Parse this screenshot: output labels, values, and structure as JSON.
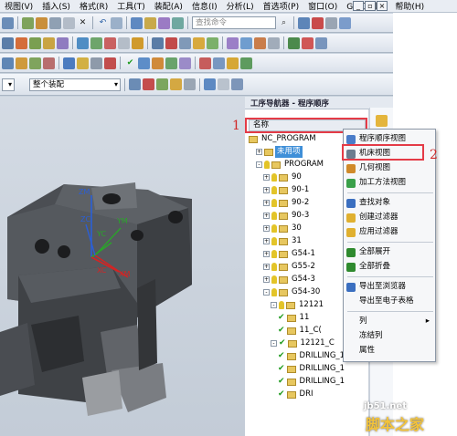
{
  "menu": [
    "视图(V)",
    "插入(S)",
    "格式(R)",
    "工具(T)",
    "装配(A)",
    "信息(I)",
    "分析(L)",
    "首选项(P)",
    "窗口(O)",
    "GC 工具箱",
    "帮助(H)"
  ],
  "window_buttons": {
    "minimize": "_",
    "restore": "▫",
    "close": "×"
  },
  "toolbar": {
    "command_search_placeholder": "查找命令",
    "assembly_select": "整个装配"
  },
  "navigator": {
    "title": "工序导航器 - 程序顺序",
    "column_header": "名称",
    "tree": [
      {
        "label": "NC_PROGRAM",
        "level": 0,
        "toggle": "",
        "bulb": false,
        "check": false
      },
      {
        "label": "未用项",
        "level": 1,
        "toggle": "+",
        "bulb": false,
        "check": false,
        "highlight": true
      },
      {
        "label": "PROGRAM",
        "level": 1,
        "toggle": "-",
        "bulb": true,
        "check": false
      },
      {
        "label": "90",
        "level": 2,
        "toggle": "+",
        "bulb": true,
        "check": false
      },
      {
        "label": "90-1",
        "level": 2,
        "toggle": "+",
        "bulb": true,
        "check": false
      },
      {
        "label": "90-2",
        "level": 2,
        "toggle": "+",
        "bulb": true,
        "check": false
      },
      {
        "label": "90-3",
        "level": 2,
        "toggle": "+",
        "bulb": true,
        "check": false
      },
      {
        "label": "30",
        "level": 2,
        "toggle": "+",
        "bulb": true,
        "check": false
      },
      {
        "label": "31",
        "level": 2,
        "toggle": "+",
        "bulb": true,
        "check": false
      },
      {
        "label": "G54-1",
        "level": 2,
        "toggle": "+",
        "bulb": true,
        "check": false
      },
      {
        "label": "G55-2",
        "level": 2,
        "toggle": "+",
        "bulb": true,
        "check": false
      },
      {
        "label": "G54-3",
        "level": 2,
        "toggle": "+",
        "bulb": true,
        "check": false
      },
      {
        "label": "G54-30",
        "level": 2,
        "toggle": "-",
        "bulb": true,
        "check": false
      },
      {
        "label": "12121",
        "level": 3,
        "toggle": "-",
        "bulb": true,
        "check": false
      },
      {
        "label": "11",
        "level": 4,
        "toggle": "",
        "bulb": false,
        "check": true
      },
      {
        "label": "11_C(",
        "level": 4,
        "toggle": "",
        "bulb": false,
        "check": true
      },
      {
        "label": "12121_C",
        "level": 3,
        "toggle": "-",
        "bulb": false,
        "check": true
      },
      {
        "label": "DRILLING_1",
        "level": 4,
        "toggle": "",
        "bulb": false,
        "check": true
      },
      {
        "label": "DRILLING_1",
        "level": 4,
        "toggle": "",
        "bulb": false,
        "check": true
      },
      {
        "label": "DRILLING_1",
        "level": 4,
        "toggle": "",
        "bulb": false,
        "check": true
      },
      {
        "label": "DRI",
        "level": 4,
        "toggle": "",
        "bulb": false,
        "check": true
      }
    ]
  },
  "context_menu": {
    "items": [
      {
        "label": "程序顺序视图",
        "icon": "program-order-view-icon",
        "color": "#4a7cc9"
      },
      {
        "label": "机床视图",
        "icon": "machine-view-icon",
        "color": "#6b7c8f",
        "boxed": true
      },
      {
        "label": "几何视图",
        "icon": "geometry-view-icon",
        "color": "#d08a2a"
      },
      {
        "label": "加工方法视图",
        "icon": "method-view-icon",
        "color": "#3aa04a"
      },
      {
        "label": "查找对象",
        "icon": "find-object-icon",
        "color": "#3b6fc0"
      },
      {
        "label": "创建过滤器",
        "icon": "create-filter-icon",
        "color": "#e0b030"
      },
      {
        "label": "应用过滤器",
        "icon": "apply-filter-icon",
        "color": "#e0b030"
      },
      {
        "label": "全部展开",
        "icon": "expand-all-icon",
        "color": "#2f8a2f"
      },
      {
        "label": "全部折叠",
        "icon": "collapse-all-icon",
        "color": "#2f8a2f"
      },
      {
        "label": "导出至浏览器",
        "icon": "export-browser-icon",
        "color": "#3b6fc0"
      },
      {
        "label": "导出至电子表格",
        "icon": "",
        "color": ""
      },
      {
        "label": "列",
        "icon": "",
        "color": "",
        "arrow": "▸"
      },
      {
        "label": "冻结列",
        "icon": "",
        "color": ""
      },
      {
        "label": "属性",
        "icon": "",
        "color": ""
      }
    ]
  },
  "callouts": {
    "one": "1",
    "two": "2"
  },
  "axes": {
    "zm": "ZM",
    "zc": "ZC",
    "ym": "YM",
    "yc": "YC",
    "xc": "XC",
    "xm": "XM"
  },
  "watermark": {
    "site": "jb51.net",
    "brand": "脚本之家"
  },
  "colors": {
    "accent": "#3f8fd8",
    "callout": "#e43b47"
  }
}
